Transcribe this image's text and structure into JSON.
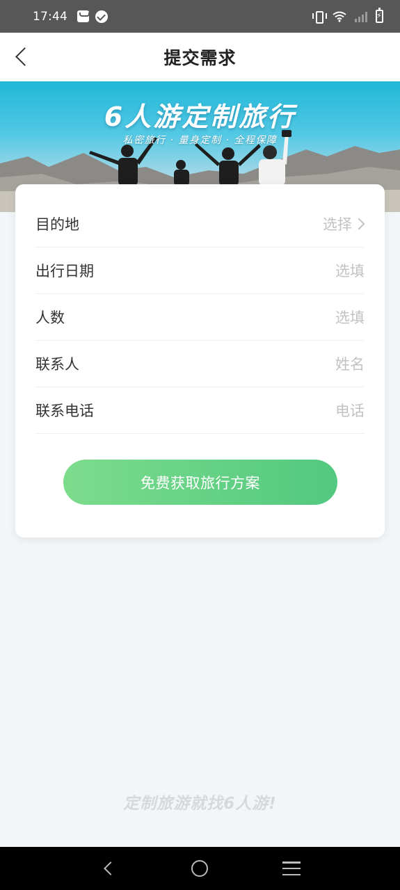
{
  "status_bar": {
    "time": "17:44",
    "icons_left": [
      "mail-icon",
      "check-circle-icon"
    ],
    "icons_right": [
      "vibrate-icon",
      "wifi-icon",
      "signal-icon",
      "battery-charging-icon"
    ]
  },
  "header": {
    "title": "提交需求",
    "back_icon": "chevron-left-icon"
  },
  "banner": {
    "title": "6人游定制旅行",
    "subtitle": "私密旅行 · 量身定制 · 全程保障"
  },
  "form": {
    "rows": [
      {
        "label": "目的地",
        "value": "选择",
        "has_chevron": true
      },
      {
        "label": "出行日期",
        "value": "选填"
      },
      {
        "label": "人数",
        "value": "选填"
      },
      {
        "label": "联系人",
        "value": "姓名"
      },
      {
        "label": "联系电话",
        "value": "电话"
      }
    ],
    "submit_label": "免费获取旅行方案"
  },
  "footer": {
    "slogan": "定制旅游就找6人游!"
  },
  "nav_bar": {
    "icons": [
      "back-icon",
      "home-icon",
      "menu-icon"
    ]
  },
  "colors": {
    "accent": "#5fd185",
    "page_bg": "#f3f6f9",
    "placeholder": "#c2c2c2"
  }
}
